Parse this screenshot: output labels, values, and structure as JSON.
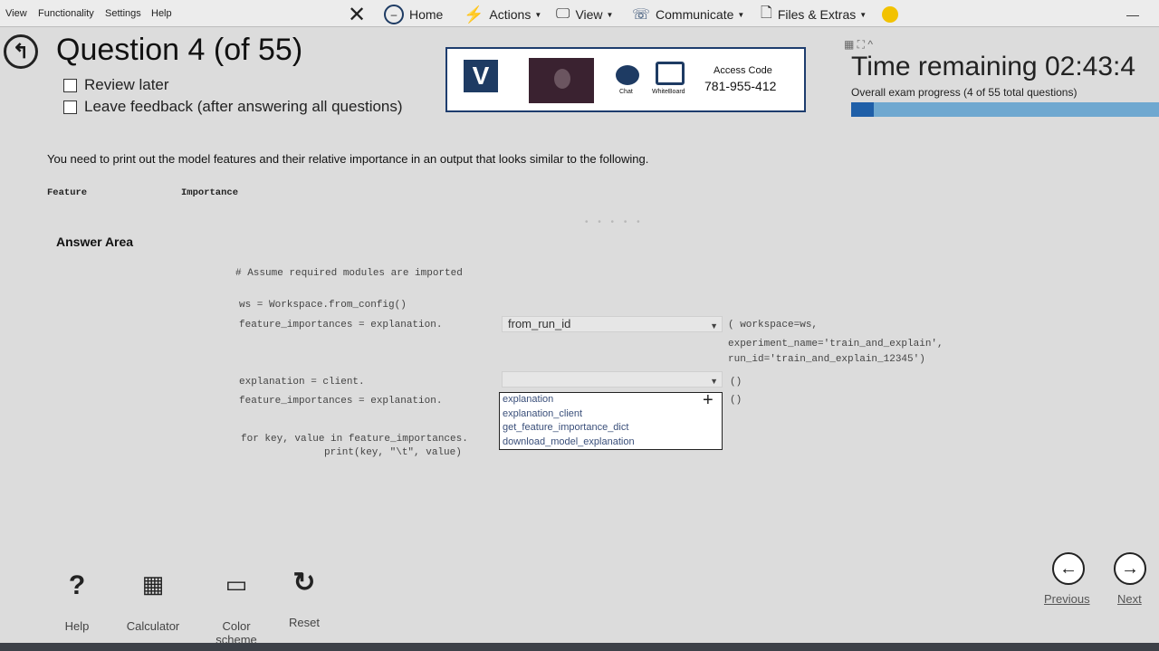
{
  "menu": {
    "items": [
      "View",
      "Functionality",
      "Settings",
      "Help"
    ],
    "toolbar": {
      "home": "Home",
      "actions": "Actions",
      "view": "View",
      "communicate": "Communicate",
      "files": "Files & Extras"
    }
  },
  "header": {
    "question_title": "Question 4 (of 55)",
    "review_later": "Review later",
    "leave_feedback": "Leave feedback (after answering all questions)"
  },
  "proctor": {
    "logo": "V",
    "chat_label": "Chat",
    "whiteboard_label": "WhiteBoard",
    "access_code_label": "Access Code",
    "access_code": "781-955-412"
  },
  "timer": {
    "time_remaining": "Time remaining 02:43:4",
    "progress_text": "Overall exam progress (4 of 55 total questions)",
    "progress_fraction": 0.073
  },
  "question": {
    "prompt": "You need to print out the model features and their relative importance in an output that looks similar to the following.",
    "col_feature": "Feature",
    "col_importance": "Importance",
    "answer_area": "Answer Area"
  },
  "code": {
    "comment": "# Assume required modules are imported",
    "line_ws": "ws = Workspace.from_config()",
    "line_fi1": "feature_importances = explanation.",
    "select1_value": "from_run_id",
    "args1": "( workspace=ws,",
    "args2": "experiment_name='train_and_explain',",
    "args3": "run_id='train_and_explain_12345')",
    "line_expl": "explanation = client.",
    "select2_value": "",
    "paren1": "()",
    "line_fi2": "feature_importances = explanation.",
    "paren2": "()",
    "line_for": "for key, value in feature_importances.",
    "line_print": "print(key, \"\\t\", value)"
  },
  "dropdown_options": [
    "explanation",
    "explanation_client",
    "get_feature_importance_dict",
    "download_model_explanation"
  ],
  "tools": {
    "help": "Help",
    "calculator": "Calculator",
    "color_scheme": "Color scheme",
    "reset": "Reset"
  },
  "nav": {
    "previous": "Previous",
    "next": "Next"
  }
}
